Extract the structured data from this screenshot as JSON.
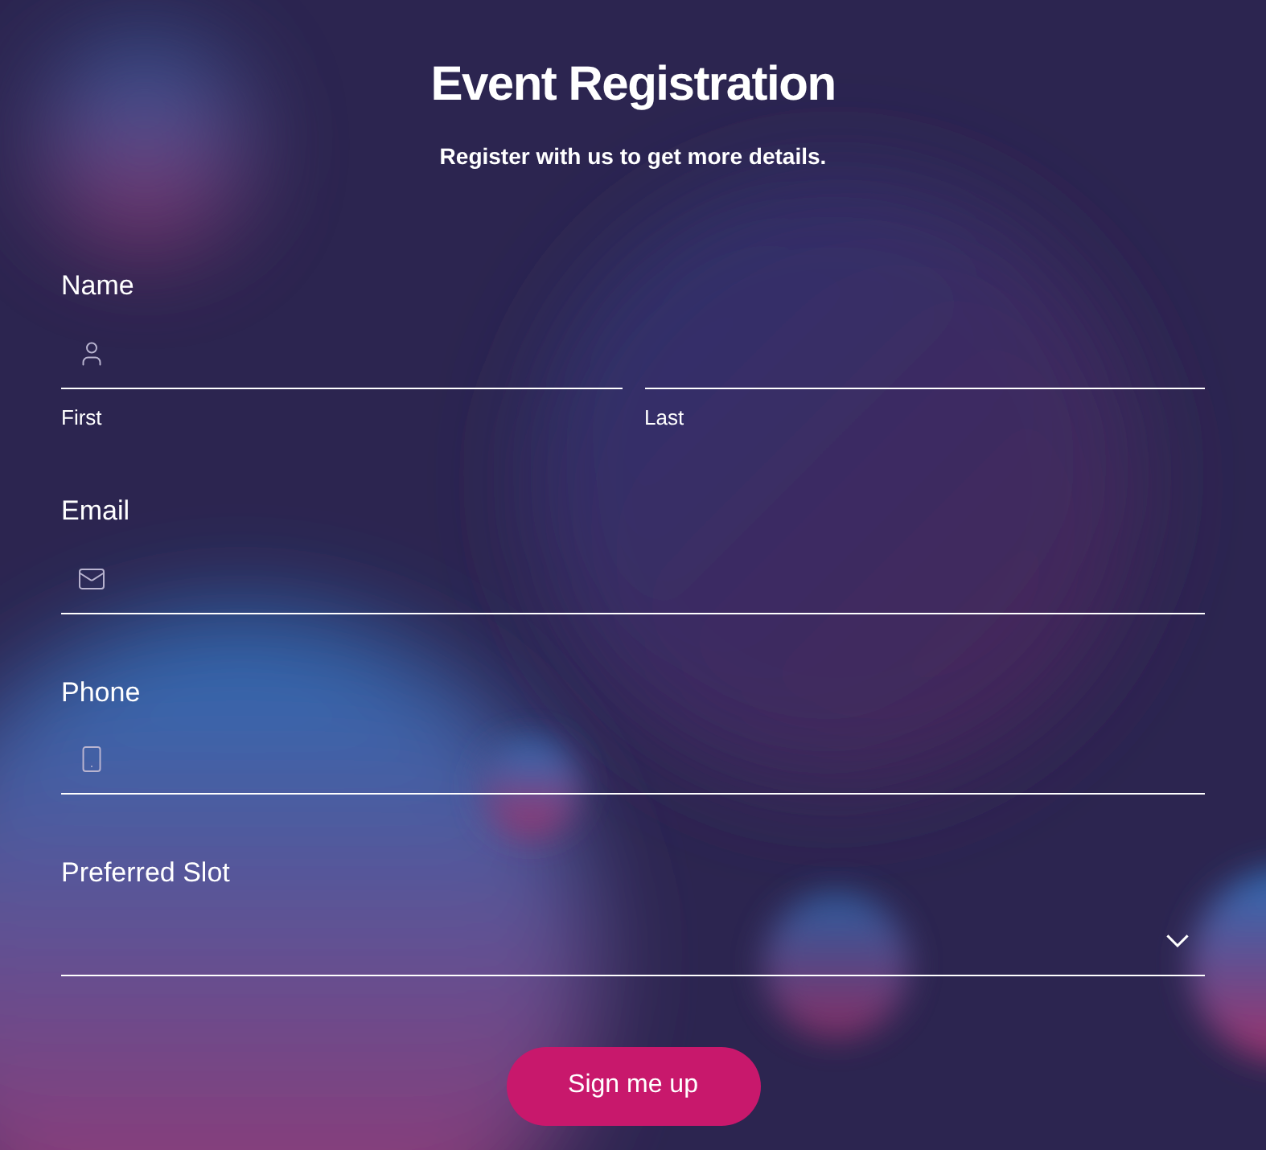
{
  "title": "Event Registration",
  "subtitle": "Register with us to get more details.",
  "fields": [
    {
      "kind": "name",
      "label": "Name",
      "sublabels": [
        "First",
        "Last"
      ]
    },
    {
      "kind": "email",
      "label": "Email"
    },
    {
      "kind": "phone",
      "label": "Phone"
    },
    {
      "kind": "select",
      "label": "Preferred Slot"
    }
  ],
  "button": "Sign me up"
}
